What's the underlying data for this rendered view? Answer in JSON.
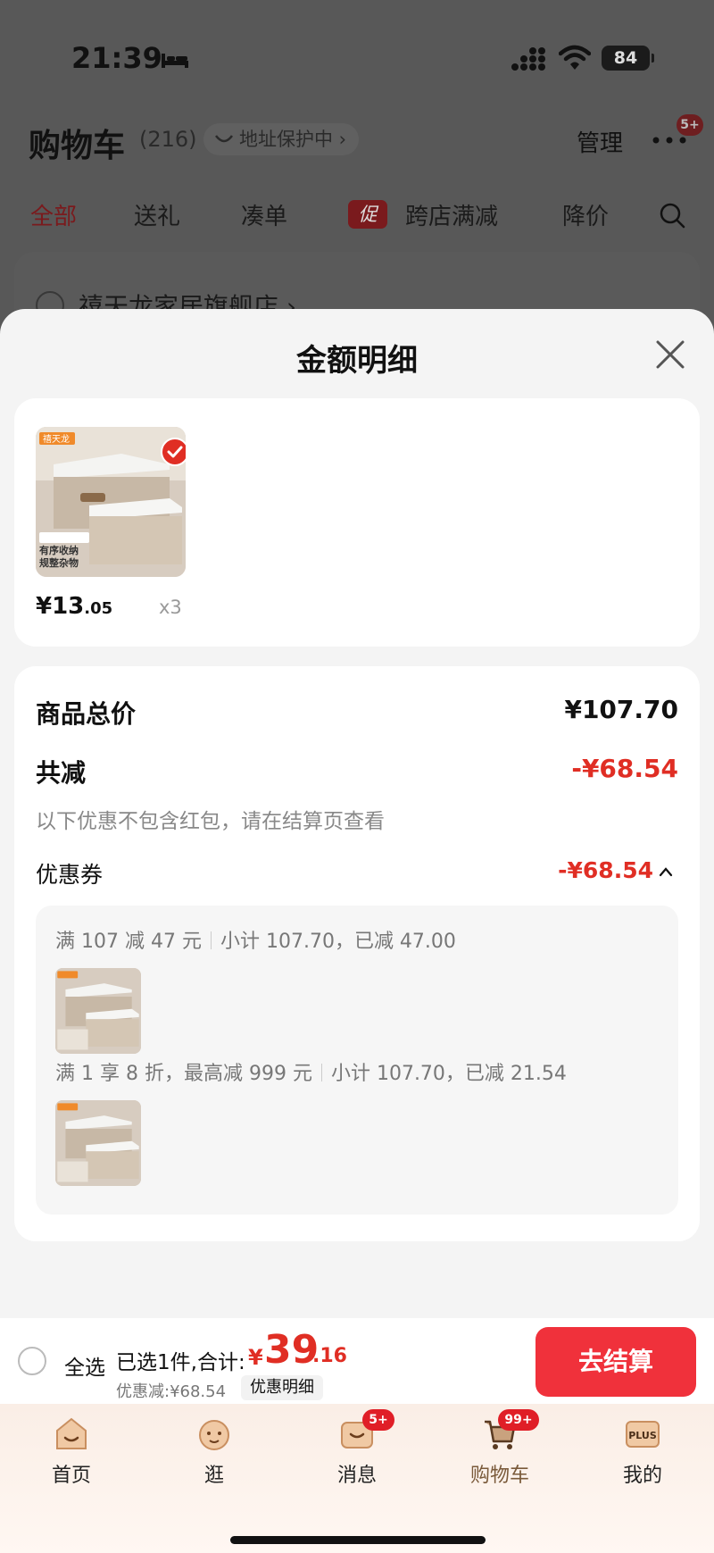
{
  "status_bar": {
    "time": "21:39",
    "battery": "84"
  },
  "header": {
    "title": "购物车",
    "count": "(216)",
    "address_pill": "地址保护中 ›",
    "manage": "管理",
    "more_badge": "5+"
  },
  "filter_tabs": [
    {
      "label": "全部",
      "active": true
    },
    {
      "label": "送礼"
    },
    {
      "label": "凑单"
    },
    {
      "label": "跨店满减",
      "tag": "促"
    },
    {
      "label": "降价"
    }
  ],
  "store": {
    "name": "禧天龙家居旗舰店 ›"
  },
  "sheet": {
    "title": "金额明细",
    "item": {
      "brand": "禧天龙",
      "caption_line1": "有序收纳",
      "caption_line2": "规整杂物",
      "price_int": "¥13",
      "price_dec": ".05",
      "qty": "x3"
    },
    "goods_total_label": "商品总价",
    "goods_total_value": "¥107.70",
    "discount_label": "共减",
    "discount_value": "-¥68.54",
    "discount_note": "以下优惠不包含红包，请在结算页查看",
    "coupon_label": "优惠券",
    "coupon_value": "-¥68.54",
    "rules": [
      {
        "condition": "满 107 减 47 元",
        "subtotal": "小计 107.70，已减 47.00"
      },
      {
        "condition": "满 1 享 8 折，最高减 999 元",
        "subtotal": "小计 107.70，已减 21.54"
      }
    ]
  },
  "checkout": {
    "select_all": "全选",
    "summary": "已选1件,合计:",
    "total_symbol": "¥",
    "total_int": "39",
    "total_dec": ".16",
    "discount_text": "优惠减:¥68.54",
    "detail_button": "优惠明细",
    "checkout_button": "去结算"
  },
  "tabbar": {
    "items": [
      {
        "label": "首页"
      },
      {
        "label": "逛"
      },
      {
        "label": "消息",
        "badge": "5+"
      },
      {
        "label": "购物车",
        "badge": "99+",
        "active": true
      },
      {
        "label": "我的",
        "icon_text": "PLUS"
      }
    ]
  },
  "colors": {
    "accent": "#e02e24",
    "button": "#f0313b"
  }
}
